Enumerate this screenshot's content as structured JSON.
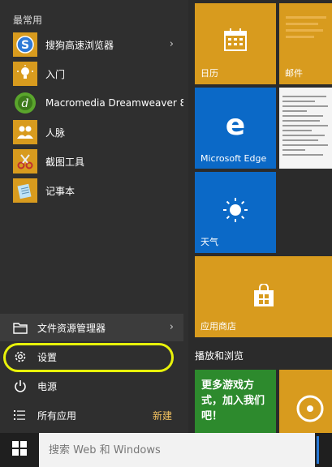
{
  "start_menu": {
    "most_used_title": "最常用",
    "apps": [
      {
        "label": "搜狗高速浏览器",
        "icon": "sogou-browser-icon",
        "has_submenu": true
      },
      {
        "label": "入门",
        "icon": "lightbulb-icon",
        "has_submenu": false
      },
      {
        "label": "Macromedia Dreamweaver 8",
        "icon": "dreamweaver-icon",
        "has_submenu": false
      },
      {
        "label": "人脉",
        "icon": "people-icon",
        "has_submenu": false
      },
      {
        "label": "截图工具",
        "icon": "scissors-icon",
        "has_submenu": false
      },
      {
        "label": "记事本",
        "icon": "notepad-icon",
        "has_submenu": false
      }
    ],
    "bottom": {
      "file_explorer": "文件资源管理器",
      "settings": "设置",
      "power": "电源",
      "all_apps": "所有应用",
      "new_badge": "新建"
    }
  },
  "tiles": {
    "calendar": "日历",
    "mail": "邮件",
    "edge": "Microsoft Edge",
    "weather": "天气",
    "store": "应用商店",
    "group_play": "播放和浏览",
    "games_text": "更多游戏方式，加入我们吧！"
  },
  "taskbar": {
    "search_placeholder": "搜索 Web 和 Windows"
  },
  "colors": {
    "accent_tile": "#d89b1e",
    "edge_tile": "#0b69c7",
    "highlight": "#e8f20a",
    "green_tile": "#2d8a2d"
  }
}
